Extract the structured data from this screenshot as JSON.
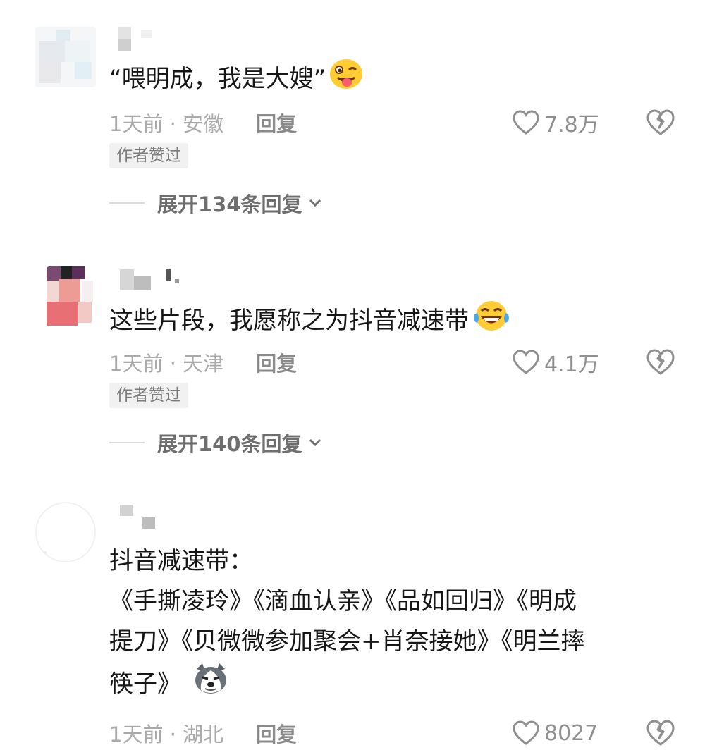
{
  "comments": [
    {
      "text": "“喂明成，我是大嫂”",
      "emoji": "winking-tongue-emoji",
      "time_location": "1天前 · 安徽",
      "reply_label": "回复",
      "likes": "7.8万",
      "badge": "作者赞过",
      "expand_label": "展开134条回复"
    },
    {
      "text": "这些片段，我愿称之为抖音减速带",
      "emoji": "tears-of-joy-emoji",
      "time_location": "1天前 · 天津",
      "reply_label": "回复",
      "likes": "4.1万",
      "badge": "作者赞过",
      "expand_label": "展开140条回复"
    },
    {
      "text_lines": [
        "抖音减速带：",
        "《手撕凌玲》《滴血认亲》《品如回归》《明成",
        "提刀》《贝微微参加聚会+肖奈接她》《明兰摔",
        "筷子》"
      ],
      "emoji": "husky-dog-emoji",
      "time_location": "1天前 · 湖北",
      "reply_label": "回复",
      "likes": "8027"
    }
  ],
  "colors": {
    "text": "#161616",
    "meta": "#a9a9a9",
    "badge_bg": "#f1f1f1"
  }
}
